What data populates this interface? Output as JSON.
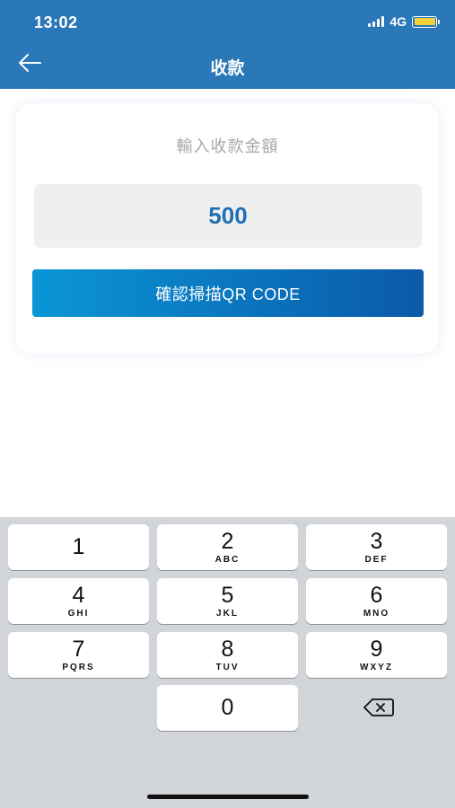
{
  "status_bar": {
    "time": "13:02",
    "network": "4G"
  },
  "header": {
    "title": "收款"
  },
  "form": {
    "prompt": "輸入收款金額",
    "amount_value": "500",
    "confirm_label": "確認掃描QR CODE"
  },
  "colors": {
    "header_bg": "#2a78b8",
    "amount_text": "#1f6fb3",
    "button_start": "#0b96d6",
    "button_end": "#0a5aa8",
    "battery": "#f2d13a"
  },
  "keypad": {
    "keys": [
      {
        "num": "1",
        "letters": ""
      },
      {
        "num": "2",
        "letters": "ABC"
      },
      {
        "num": "3",
        "letters": "DEF"
      },
      {
        "num": "4",
        "letters": "GHI"
      },
      {
        "num": "5",
        "letters": "JKL"
      },
      {
        "num": "6",
        "letters": "MNO"
      },
      {
        "num": "7",
        "letters": "PQRS"
      },
      {
        "num": "8",
        "letters": "TUV"
      },
      {
        "num": "9",
        "letters": "WXYZ"
      },
      {
        "num": "0",
        "letters": ""
      }
    ],
    "delete_icon": "backspace-icon"
  }
}
